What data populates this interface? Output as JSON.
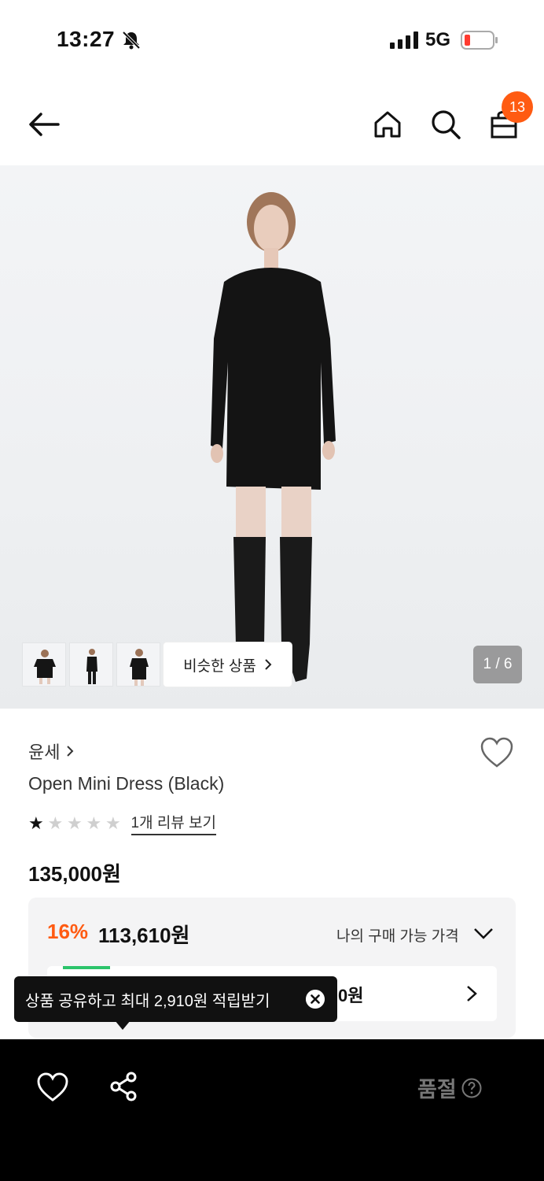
{
  "status_bar": {
    "time": "13:27",
    "network": "5G"
  },
  "header": {
    "cart_count": "13"
  },
  "gallery": {
    "similar_label": "비슷한 상품",
    "page_counter": "1 / 6"
  },
  "product": {
    "brand": "윤세",
    "name": "Open Mini Dress (Black)",
    "rating": {
      "stars_filled": 1,
      "stars_total": 5
    },
    "review_link": "1개 리뷰 보기",
    "list_price": "135,000원"
  },
  "price_box": {
    "discount_pct": "16%",
    "sale_price": "113,610원",
    "my_price_label": "나의 구매 가능 가격",
    "benefit_suffix": "0원"
  },
  "tooltip": {
    "text": "상품 공유하고 최대 2,910원 적립받기"
  },
  "bottom_bar": {
    "status_label": "품절"
  },
  "colors": {
    "accent": "#ff5b12",
    "bottom_bar": "#000000",
    "benefit_green": "#2cc46b"
  }
}
